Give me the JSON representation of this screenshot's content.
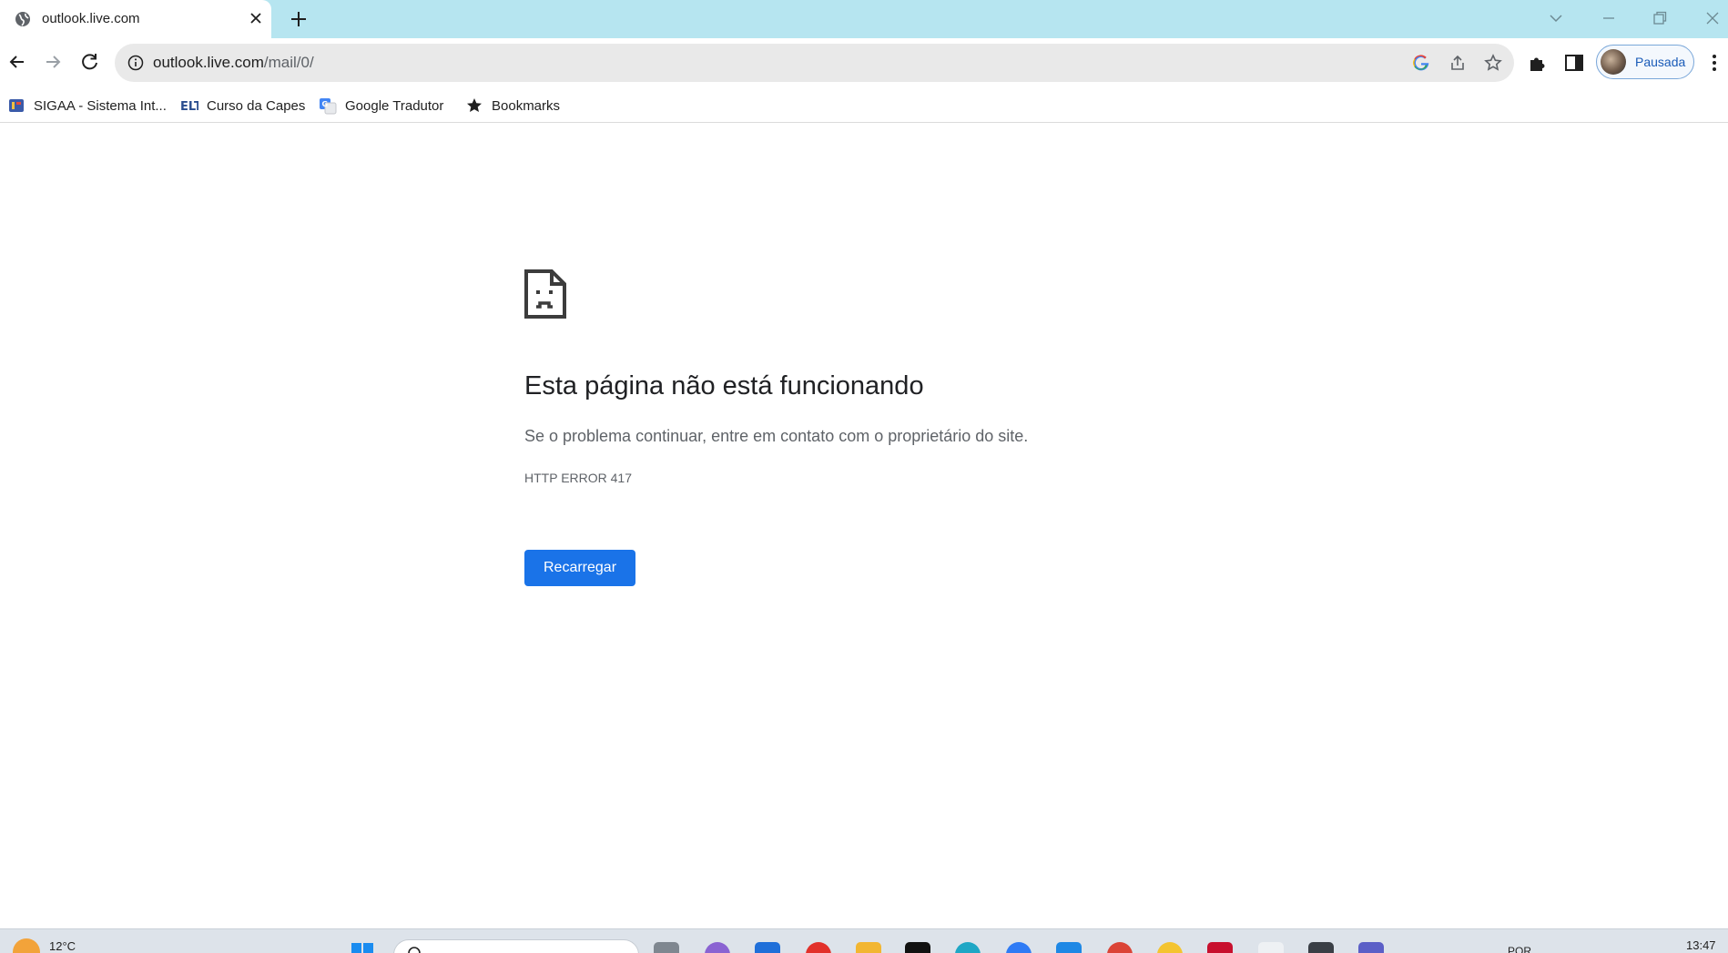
{
  "browser": {
    "tab": {
      "title": "outlook.live.com",
      "favicon": "globe-icon"
    },
    "address": {
      "host": "outlook.live.com",
      "path": "/mail/0/"
    },
    "profile": {
      "label": "Pausada"
    }
  },
  "bookmarks": [
    {
      "label": "SIGAA - Sistema Int...",
      "icon": "sigaa-icon"
    },
    {
      "label": "Curso da Capes",
      "icon": "elt-icon"
    },
    {
      "label": "Google Tradutor",
      "icon": "translate-icon"
    },
    {
      "label": "Bookmarks",
      "icon": "star-icon"
    }
  ],
  "error_page": {
    "title": "Esta página não está funcionando",
    "description": "Se o problema continuar, entre em contato com o proprietário do site.",
    "code": "HTTP ERROR 417",
    "reload_label": "Recarregar"
  },
  "taskbar": {
    "weather_temp": "12°C",
    "clock": "13:47",
    "tray_lang": "POR"
  },
  "colors": {
    "tabstrip": "#b6e5f0",
    "button_blue": "#1a73e8",
    "profile_text": "#1a5bb8"
  }
}
